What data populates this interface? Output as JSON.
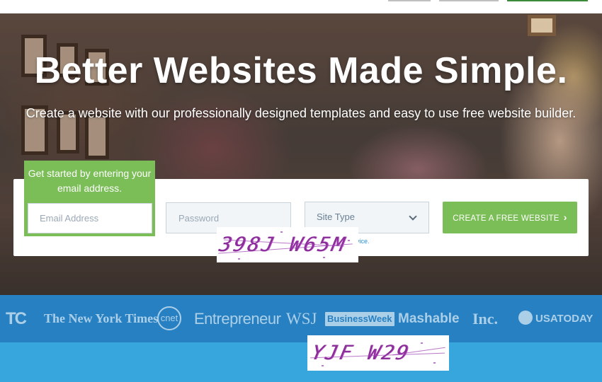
{
  "hero": {
    "title": "Better Websites Made Simple.",
    "subtitle": "Create a website with our professionally designed templates and easy to use free website builder."
  },
  "signup": {
    "tab_text": "Get started by entering your email address.",
    "email_placeholder": "Email Address",
    "password_placeholder": "Password",
    "site_type_label": "Site Type",
    "cta_label": "CREATE A FREE WEBSITE",
    "cta_arrow": "›",
    "legal_snippet": "vice."
  },
  "captchas": [
    {
      "text": "398J W65M"
    },
    {
      "text": "YJF W29"
    }
  ],
  "press_logos": [
    {
      "name": "TechCrunch",
      "text": "TC"
    },
    {
      "name": "The New York Times",
      "text": "The New York Times"
    },
    {
      "name": "CNET",
      "text": "cnet"
    },
    {
      "name": "Entrepreneur",
      "text": "Entrepreneur"
    },
    {
      "name": "WSJ",
      "text": "WSJ"
    },
    {
      "name": "BusinessWeek",
      "text": "BusinessWeek"
    },
    {
      "name": "Mashable",
      "text": "Mashable"
    },
    {
      "name": "Inc.",
      "text": "Inc."
    },
    {
      "name": "USA TODAY",
      "text": "USATODAY"
    }
  ],
  "colors": {
    "brand_green": "#7bbd57",
    "press_blue": "#2680c2",
    "lower_blue": "#37a6dd",
    "captcha_purple": "#8a2f9a"
  }
}
